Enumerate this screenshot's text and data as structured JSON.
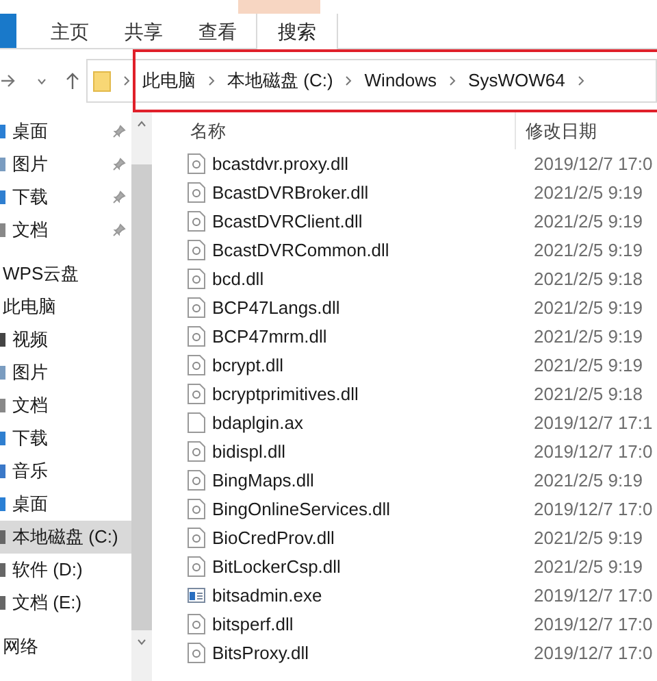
{
  "ribbon_tabs": [
    {
      "label": "主页",
      "selected": false
    },
    {
      "label": "共享",
      "selected": false
    },
    {
      "label": "查看",
      "selected": false
    },
    {
      "label": "搜索",
      "selected": true
    }
  ],
  "address_bar": {
    "crumbs": [
      "此电脑",
      "本地磁盘 (C:)",
      "Windows",
      "SysWOW64"
    ]
  },
  "sidebar": {
    "items": [
      {
        "label": "桌面",
        "kind": "item",
        "pinned": true,
        "selected": false
      },
      {
        "label": "图片",
        "kind": "item",
        "pinned": true,
        "selected": false
      },
      {
        "label": "下载",
        "kind": "item",
        "pinned": true,
        "selected": false
      },
      {
        "label": "文档",
        "kind": "item",
        "pinned": true,
        "selected": false
      },
      {
        "label": "WPS云盘",
        "kind": "header"
      },
      {
        "label": "此电脑",
        "kind": "header"
      },
      {
        "label": "视频",
        "kind": "item",
        "pinned": false,
        "selected": false
      },
      {
        "label": "图片",
        "kind": "item",
        "pinned": false,
        "selected": false
      },
      {
        "label": "文档",
        "kind": "item",
        "pinned": false,
        "selected": false
      },
      {
        "label": "下载",
        "kind": "item",
        "pinned": false,
        "selected": false
      },
      {
        "label": "音乐",
        "kind": "item",
        "pinned": false,
        "selected": false
      },
      {
        "label": "桌面",
        "kind": "item",
        "pinned": false,
        "selected": false
      },
      {
        "label": "本地磁盘 (C:)",
        "kind": "item",
        "pinned": false,
        "selected": true
      },
      {
        "label": "软件 (D:)",
        "kind": "item",
        "pinned": false,
        "selected": false
      },
      {
        "label": "文档 (E:)",
        "kind": "item",
        "pinned": false,
        "selected": false
      },
      {
        "label": "网络",
        "kind": "header"
      }
    ]
  },
  "file_list": {
    "columns": [
      "名称",
      "修改日期"
    ],
    "rows": [
      {
        "name": "bcastdvr.proxy.dll",
        "date": "2019/12/7 17:0",
        "kind": "dll"
      },
      {
        "name": "BcastDVRBroker.dll",
        "date": "2021/2/5 9:19",
        "kind": "dll"
      },
      {
        "name": "BcastDVRClient.dll",
        "date": "2021/2/5 9:19",
        "kind": "dll"
      },
      {
        "name": "BcastDVRCommon.dll",
        "date": "2021/2/5 9:19",
        "kind": "dll"
      },
      {
        "name": "bcd.dll",
        "date": "2021/2/5 9:18",
        "kind": "dll"
      },
      {
        "name": "BCP47Langs.dll",
        "date": "2021/2/5 9:19",
        "kind": "dll"
      },
      {
        "name": "BCP47mrm.dll",
        "date": "2021/2/5 9:19",
        "kind": "dll"
      },
      {
        "name": "bcrypt.dll",
        "date": "2021/2/5 9:19",
        "kind": "dll"
      },
      {
        "name": "bcryptprimitives.dll",
        "date": "2021/2/5 9:18",
        "kind": "dll"
      },
      {
        "name": "bdaplgin.ax",
        "date": "2019/12/7 17:1",
        "kind": "file"
      },
      {
        "name": "bidispl.dll",
        "date": "2019/12/7 17:0",
        "kind": "dll"
      },
      {
        "name": "BingMaps.dll",
        "date": "2021/2/5 9:19",
        "kind": "dll"
      },
      {
        "name": "BingOnlineServices.dll",
        "date": "2019/12/7 17:0",
        "kind": "dll"
      },
      {
        "name": "BioCredProv.dll",
        "date": "2021/2/5 9:19",
        "kind": "dll"
      },
      {
        "name": "BitLockerCsp.dll",
        "date": "2021/2/5 9:19",
        "kind": "dll"
      },
      {
        "name": "bitsadmin.exe",
        "date": "2019/12/7 17:0",
        "kind": "exe"
      },
      {
        "name": "bitsperf.dll",
        "date": "2019/12/7 17:0",
        "kind": "dll"
      },
      {
        "name": "BitsProxy.dll",
        "date": "2019/12/7 17:0",
        "kind": "dll"
      }
    ]
  }
}
